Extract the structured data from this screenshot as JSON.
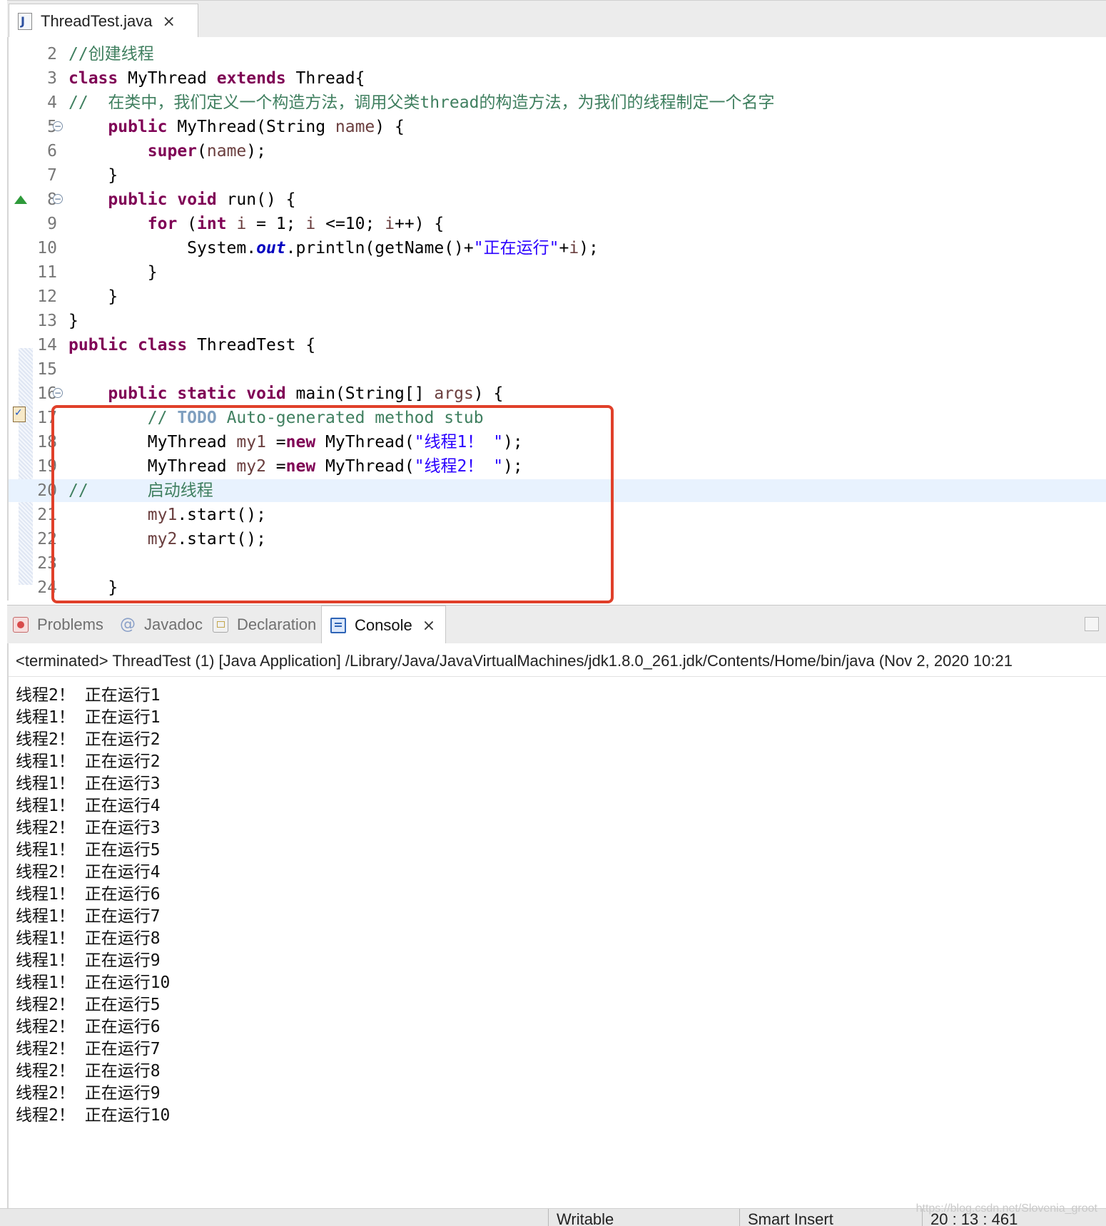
{
  "editor": {
    "tab_label": "ThreadTest.java",
    "file_icon_letter": "J",
    "lines": [
      {
        "n": "2",
        "parts": [
          {
            "t": "//创建线程",
            "c": "cm"
          }
        ]
      },
      {
        "n": "3",
        "parts": [
          {
            "t": "class",
            "c": "kw"
          },
          {
            "t": " MyThread ",
            "c": ""
          },
          {
            "t": "extends",
            "c": "kw"
          },
          {
            "t": " Thread{",
            "c": ""
          }
        ]
      },
      {
        "n": "4",
        "parts": [
          {
            "t": "//  在类中，我们定义一个构造方法，调用父类thread的构造方法，为我们的线程制定一个名字",
            "c": "cm"
          }
        ]
      },
      {
        "n": "5",
        "fold": true,
        "parts": [
          {
            "t": "    ",
            "c": ""
          },
          {
            "t": "public",
            "c": "kw"
          },
          {
            "t": " MyThread(String ",
            "c": ""
          },
          {
            "t": "name",
            "c": "var"
          },
          {
            "t": ") {",
            "c": ""
          }
        ]
      },
      {
        "n": "6",
        "parts": [
          {
            "t": "        ",
            "c": ""
          },
          {
            "t": "super",
            "c": "kw"
          },
          {
            "t": "(",
            "c": ""
          },
          {
            "t": "name",
            "c": "var"
          },
          {
            "t": ");",
            "c": ""
          }
        ]
      },
      {
        "n": "7",
        "parts": [
          {
            "t": "    }",
            "c": ""
          }
        ]
      },
      {
        "n": "8",
        "fold": true,
        "override": true,
        "parts": [
          {
            "t": "    ",
            "c": ""
          },
          {
            "t": "public",
            "c": "kw"
          },
          {
            "t": " ",
            "c": ""
          },
          {
            "t": "void",
            "c": "kw"
          },
          {
            "t": " run() {",
            "c": ""
          }
        ]
      },
      {
        "n": "9",
        "parts": [
          {
            "t": "        ",
            "c": ""
          },
          {
            "t": "for",
            "c": "kw"
          },
          {
            "t": " (",
            "c": ""
          },
          {
            "t": "int",
            "c": "kw"
          },
          {
            "t": " ",
            "c": ""
          },
          {
            "t": "i",
            "c": "var"
          },
          {
            "t": " = 1; ",
            "c": ""
          },
          {
            "t": "i",
            "c": "var"
          },
          {
            "t": " <=10; ",
            "c": ""
          },
          {
            "t": "i",
            "c": "var"
          },
          {
            "t": "++) {",
            "c": ""
          }
        ]
      },
      {
        "n": "10",
        "parts": [
          {
            "t": "            System.",
            "c": ""
          },
          {
            "t": "out",
            "c": "fld"
          },
          {
            "t": ".println(getName()+",
            "c": ""
          },
          {
            "t": "\"正在运行\"",
            "c": "str"
          },
          {
            "t": "+",
            "c": ""
          },
          {
            "t": "i",
            "c": "var"
          },
          {
            "t": ");",
            "c": ""
          }
        ]
      },
      {
        "n": "11",
        "parts": [
          {
            "t": "        }",
            "c": ""
          }
        ]
      },
      {
        "n": "12",
        "parts": [
          {
            "t": "    }",
            "c": ""
          }
        ]
      },
      {
        "n": "13",
        "parts": [
          {
            "t": "}",
            "c": ""
          }
        ]
      },
      {
        "n": "14",
        "parts": [
          {
            "t": "public",
            "c": "kw"
          },
          {
            "t": " ",
            "c": ""
          },
          {
            "t": "class",
            "c": "kw"
          },
          {
            "t": " ThreadTest {",
            "c": ""
          }
        ]
      },
      {
        "n": "15",
        "parts": []
      },
      {
        "n": "16",
        "fold": true,
        "parts": [
          {
            "t": "    ",
            "c": ""
          },
          {
            "t": "public",
            "c": "kw"
          },
          {
            "t": " ",
            "c": ""
          },
          {
            "t": "static",
            "c": "kw"
          },
          {
            "t": " ",
            "c": ""
          },
          {
            "t": "void",
            "c": "kw"
          },
          {
            "t": " main(String[] ",
            "c": ""
          },
          {
            "t": "args",
            "c": "var"
          },
          {
            "t": ") {",
            "c": ""
          }
        ]
      },
      {
        "n": "17",
        "parts": [
          {
            "t": "        // ",
            "c": "cm"
          },
          {
            "t": "TODO",
            "c": "todo"
          },
          {
            "t": " Auto-generated method stub",
            "c": "cm"
          }
        ]
      },
      {
        "n": "18",
        "parts": [
          {
            "t": "        MyThread ",
            "c": ""
          },
          {
            "t": "my1",
            "c": "var"
          },
          {
            "t": " =",
            "c": ""
          },
          {
            "t": "new",
            "c": "kw"
          },
          {
            "t": " MyThread(",
            "c": ""
          },
          {
            "t": "\"线程1！ \"",
            "c": "str"
          },
          {
            "t": ");",
            "c": ""
          }
        ]
      },
      {
        "n": "19",
        "parts": [
          {
            "t": "        MyThread ",
            "c": ""
          },
          {
            "t": "my2",
            "c": "var"
          },
          {
            "t": " =",
            "c": ""
          },
          {
            "t": "new",
            "c": "kw"
          },
          {
            "t": " MyThread(",
            "c": ""
          },
          {
            "t": "\"线程2！ \"",
            "c": "str"
          },
          {
            "t": ");",
            "c": ""
          }
        ]
      },
      {
        "n": "20",
        "current": true,
        "parts": [
          {
            "t": "//      启动线程",
            "c": "cm"
          }
        ]
      },
      {
        "n": "21",
        "parts": [
          {
            "t": "        ",
            "c": ""
          },
          {
            "t": "my1",
            "c": "var"
          },
          {
            "t": ".start();",
            "c": ""
          }
        ]
      },
      {
        "n": "22",
        "parts": [
          {
            "t": "        ",
            "c": ""
          },
          {
            "t": "my2",
            "c": "var"
          },
          {
            "t": ".start();",
            "c": ""
          }
        ]
      },
      {
        "n": "23",
        "parts": []
      },
      {
        "n": "24",
        "parts": [
          {
            "t": "    }",
            "c": ""
          }
        ]
      }
    ]
  },
  "views": {
    "tabs": [
      {
        "label": "Problems",
        "icon": "problems-icon",
        "active": false
      },
      {
        "label": "Javadoc",
        "icon": "javadoc-at-icon",
        "active": false
      },
      {
        "label": "Declaration",
        "icon": "declaration-icon",
        "active": false
      },
      {
        "label": "Console",
        "icon": "console-icon",
        "active": true
      }
    ]
  },
  "console": {
    "header": "<terminated> ThreadTest (1) [Java Application] /Library/Java/JavaVirtualMachines/jdk1.8.0_261.jdk/Contents/Home/bin/java  (Nov 2, 2020 10:21",
    "output": [
      "线程2！ 正在运行1",
      "线程1！ 正在运行1",
      "线程2！ 正在运行2",
      "线程1！ 正在运行2",
      "线程1！ 正在运行3",
      "线程1！ 正在运行4",
      "线程2！ 正在运行3",
      "线程1！ 正在运行5",
      "线程2！ 正在运行4",
      "线程1！ 正在运行6",
      "线程1！ 正在运行7",
      "线程1！ 正在运行8",
      "线程1！ 正在运行9",
      "线程1！ 正在运行10",
      "线程2！ 正在运行5",
      "线程2！ 正在运行6",
      "线程2！ 正在运行7",
      "线程2！ 正在运行8",
      "线程2！ 正在运行9",
      "线程2！ 正在运行10"
    ]
  },
  "status": {
    "writable": "Writable",
    "insert_mode": "Smart Insert",
    "position": "20 : 13 : 461",
    "watermark": "https://blog.csdn.net/Slovenia_groot"
  },
  "colors": {
    "keyword": "#7f0055",
    "comment": "#3f7f5f",
    "string": "#2a00ff",
    "highlight_box": "#e0402a",
    "current_line": "#e8f2fe"
  }
}
